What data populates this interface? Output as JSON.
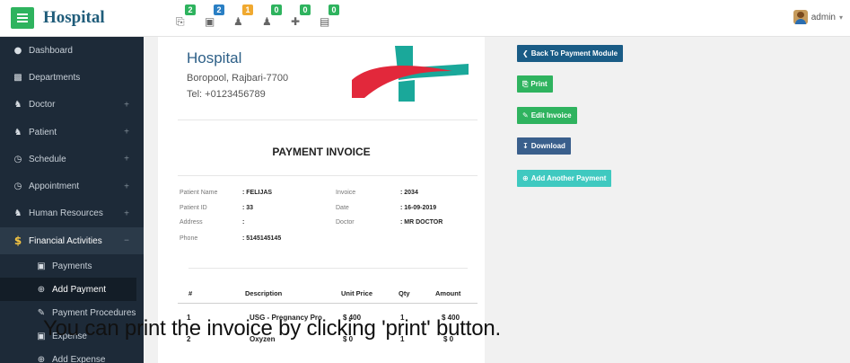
{
  "brand": {
    "title": "Hospital"
  },
  "notifications": [
    {
      "icon": "printer-icon",
      "count": "2",
      "color": "#2eb35e"
    },
    {
      "icon": "money-icon",
      "count": "2",
      "color": "#2a7fc4"
    },
    {
      "icon": "user-icon",
      "count": "1",
      "color": "#f0a930"
    },
    {
      "icon": "user-icon",
      "count": "0",
      "color": "#2eb35e"
    },
    {
      "icon": "medkit-icon",
      "count": "0",
      "color": "#2eb35e"
    },
    {
      "icon": "clipboard-icon",
      "count": "0",
      "color": "#2eb35e"
    }
  ],
  "user": {
    "name": "admin"
  },
  "sidebar": {
    "items": [
      {
        "label": "Dashboard",
        "icon": "dashboard-icon",
        "expandable": false
      },
      {
        "label": "Departments",
        "icon": "sitemap-icon",
        "expandable": false
      },
      {
        "label": "Doctor",
        "icon": "users-icon",
        "expandable": true
      },
      {
        "label": "Patient",
        "icon": "users-icon",
        "expandable": true
      },
      {
        "label": "Schedule",
        "icon": "clock-icon",
        "expandable": true
      },
      {
        "label": "Appointment",
        "icon": "clock-icon",
        "expandable": true
      },
      {
        "label": "Human Resources",
        "icon": "users-icon",
        "expandable": true
      },
      {
        "label": "Financial Activities",
        "icon": "dollar-icon",
        "expandable": true,
        "active": true
      }
    ],
    "subitems": [
      {
        "label": "Payments",
        "icon": "money-icon"
      },
      {
        "label": "Add Payment",
        "icon": "plus-circle-icon",
        "selected": true
      },
      {
        "label": "Payment Procedures",
        "icon": "edit-icon"
      },
      {
        "label": "Expense",
        "icon": "money-icon"
      },
      {
        "label": "Add Expense",
        "icon": "plus-circle-icon"
      }
    ],
    "plus_sign": "+",
    "minus_sign": "−"
  },
  "invoice": {
    "hospital_name": "Hospital",
    "address": "Boropool, Rajbari-7700",
    "tel": "Tel: +0123456789",
    "title": "PAYMENT INVOICE",
    "patient_name_label": "Patient Name",
    "patient_name": ": FELIJAS",
    "patient_id_label": "Patient ID",
    "patient_id": ": 33",
    "address_label": "Address",
    "address_val": ":",
    "phone_label": "Phone",
    "phone": ": 5145145145",
    "invoice_label": "Invoice",
    "invoice_no": ": 2034",
    "date_label": "Date",
    "date": ": 16-09-2019",
    "doctor_label": "Doctor",
    "doctor": ": MR DOCTOR",
    "columns": [
      "#",
      "Description",
      "Unit Price",
      "Qty",
      "Amount"
    ],
    "rows": [
      {
        "no": "1",
        "description": "USG - Pregnancy Pro",
        "unit_price": "$ 400",
        "qty": "1",
        "amount": "$ 400"
      },
      {
        "no": "2",
        "description": "Oxyzen",
        "unit_price": "$ 0",
        "qty": "1",
        "amount": "$ 0"
      }
    ]
  },
  "actions": {
    "back": "Back To Payment Module",
    "print": "Print",
    "edit": "Edit Invoice",
    "download": "Download",
    "add_another": "Add Another Payment"
  },
  "caption": "You can print the invoice by clicking 'print' button."
}
